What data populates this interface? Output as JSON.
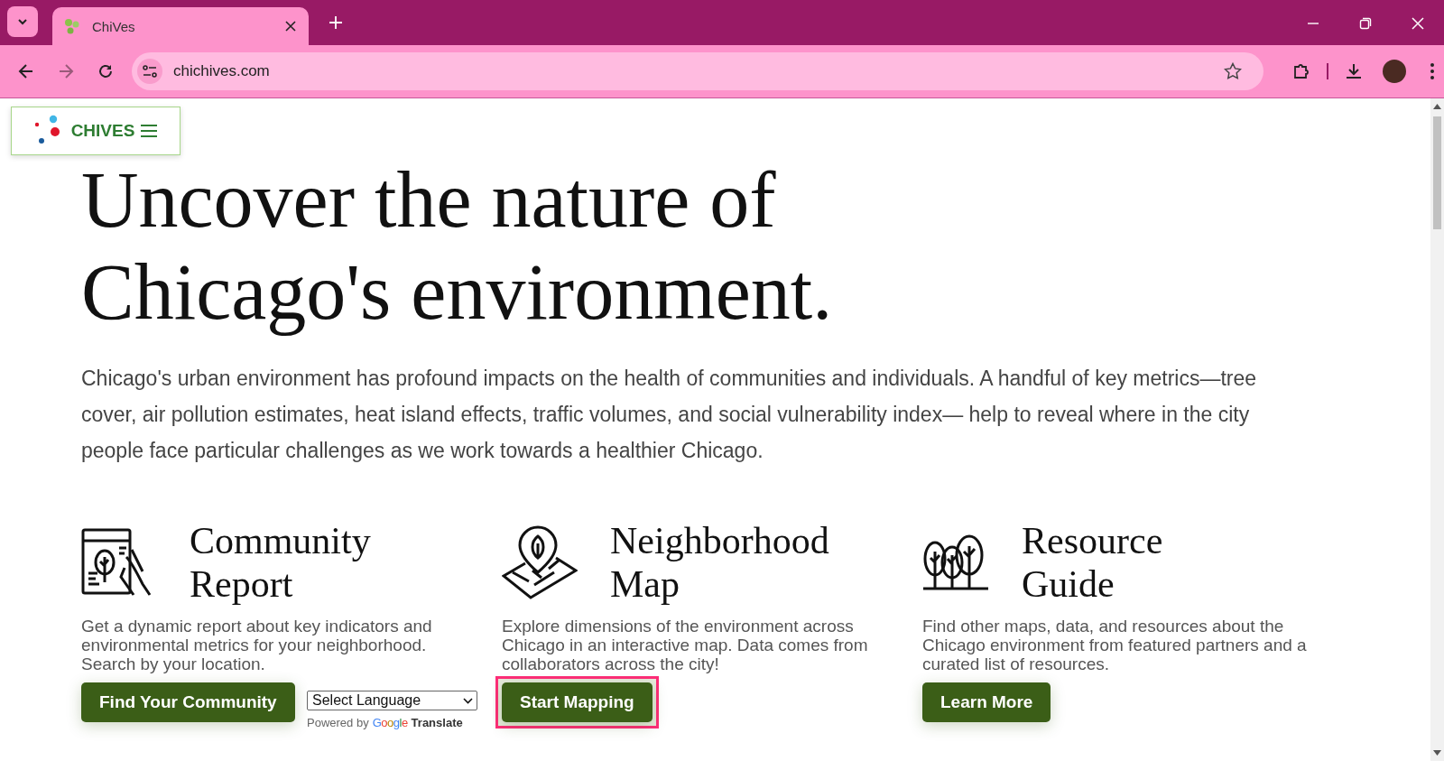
{
  "browser": {
    "tabs": [
      {
        "title": "ChiVes",
        "selected": true
      }
    ],
    "url": "chichives.com"
  },
  "site": {
    "brand": "CHIVES",
    "hero": {
      "title_lines": [
        "Uncover the nature of",
        "Chicago's environment."
      ],
      "intro": "Chicago's urban environment has profound impacts on the health of communities and individuals. A handful of key metrics—tree cover, air pollution estimates, heat island effects, traffic volumes, and social vulnerability index— help to reveal where in the city people face particular challenges as we work towards a healthier Chicago."
    },
    "cards": [
      {
        "kind": "report",
        "title_lines": [
          "Community",
          "Report"
        ],
        "description": "Get a dynamic report about key indicators and environmental metrics for your neighborhood. Search by your location.",
        "button": {
          "label": "Find Your Community",
          "highlighted": false
        }
      },
      {
        "kind": "map",
        "title_lines": [
          "Neighborhood",
          "Map"
        ],
        "description": "Explore dimensions of the environment across Chicago in an interactive map. Data comes from collaborators across the city!",
        "button": {
          "label": "Start Mapping",
          "highlighted": true
        }
      },
      {
        "kind": "trees",
        "title_lines": [
          "Resource",
          "Guide"
        ],
        "description": "Find other maps, data, and resources about the Chicago environment from featured partners and a curated list of resources.",
        "button": {
          "label": "Learn More",
          "highlighted": false
        }
      }
    ],
    "translate": {
      "select": "Select Language",
      "powered_by": "Powered by",
      "google": "Google",
      "translate": "Translate"
    }
  }
}
